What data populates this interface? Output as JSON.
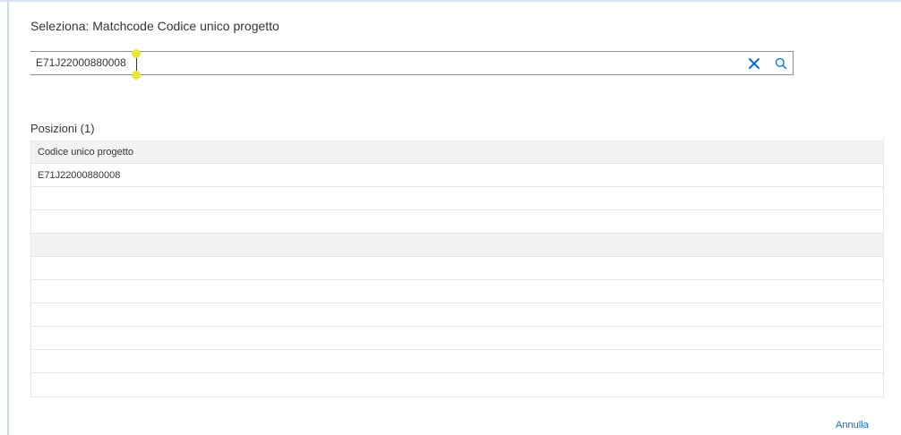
{
  "dialog": {
    "title": "Seleziona: Matchcode Codice unico progetto"
  },
  "search": {
    "value": "E71J22000880008",
    "clear_icon": "close-icon",
    "search_icon": "search-icon"
  },
  "positions": {
    "title": "Posizioni (1)",
    "columns": [
      "Codice unico progetto"
    ],
    "rows": [
      {
        "codice": "E71J22000880008"
      }
    ]
  },
  "footer": {
    "cancel_label": "Annulla"
  },
  "colors": {
    "accent": "#0a6ed1",
    "icon": "#0a6ed1",
    "text": "#32363a",
    "header_bg": "#f2f2f2",
    "border": "#e5e5e5"
  }
}
